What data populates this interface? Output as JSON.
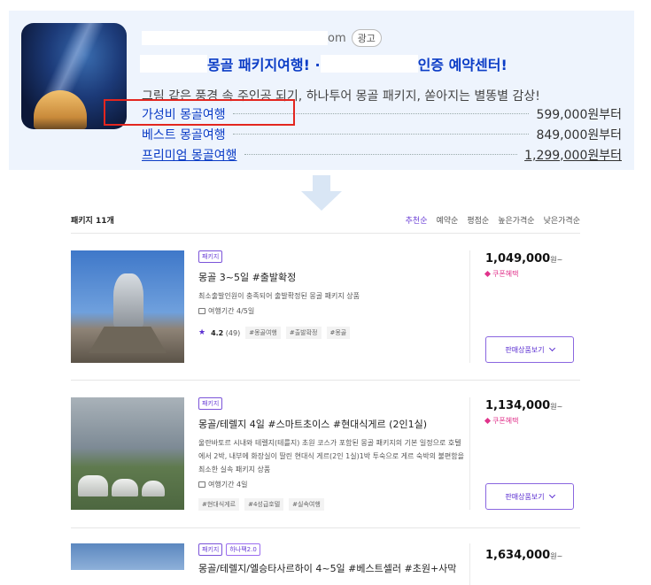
{
  "ad": {
    "url_suffix": "om",
    "badge": "광고",
    "title_visible": "몽골 패키지여행! ·",
    "title_end": "인증 예약센터!",
    "description": "그림 같은 풍경 속 주인공 되기, 하나투어 몽골 패키지, 쏟아지는 별똥별 감상!",
    "rows": [
      {
        "label": "가성비 몽골여행",
        "price": "599,000원부터"
      },
      {
        "label": "베스트 몽골여행",
        "price": "849,000원부터"
      },
      {
        "label": "프리미엄 몽골여행",
        "price": "1,299,000원부터"
      }
    ]
  },
  "list": {
    "count": "패키지 11개",
    "sorts": [
      "추천순",
      "예약순",
      "평점순",
      "높은가격순",
      "낮은가격순"
    ],
    "active_sort": "추천순"
  },
  "items": [
    {
      "tags": [
        "패키지"
      ],
      "title": "몽골 3~5일 #출발확정",
      "desc": "최소출발인원이 충족되어 출발확정된 몽골 패키지 상품",
      "duration": "여행기간 4/5일",
      "rating": "4.2",
      "reviews": "(49)",
      "hashtags": [
        "#몽골여행",
        "#출발확정",
        "#몽골"
      ],
      "price": "1,049,000",
      "price_unit": "원~",
      "coupon": "쿠폰혜택",
      "button": "판매상품보기"
    },
    {
      "tags": [
        "패키지"
      ],
      "title": "몽골/테렐지 4일 #스마트초이스 #현대식게르 (2인1실)",
      "desc": "울란바토르 시내와 테렐지(테를지) 초원 코스가 포함된 몽골 패키지의 기본 일정으로 호텔에서 2박, 내부에 화장실이 딸린 현대식 게르(2인 1실)1박 투숙으로 게르 숙박의 불편함을 최소한 실속 패키지 상품",
      "duration": "여행기간 4일",
      "hashtags": [
        "#현대식게르",
        "#4성급호텔",
        "#실속여행"
      ],
      "price": "1,134,000",
      "price_unit": "원~",
      "coupon": "쿠폰혜택",
      "button": "판매상품보기"
    },
    {
      "tags": [
        "패키지",
        "하나팩2.0"
      ],
      "title": "몽골/테렐지/엘승타사르하이 4~5일 #베스트셀러 #초원+사막",
      "price": "1,634,000",
      "price_unit": "원~"
    }
  ]
}
